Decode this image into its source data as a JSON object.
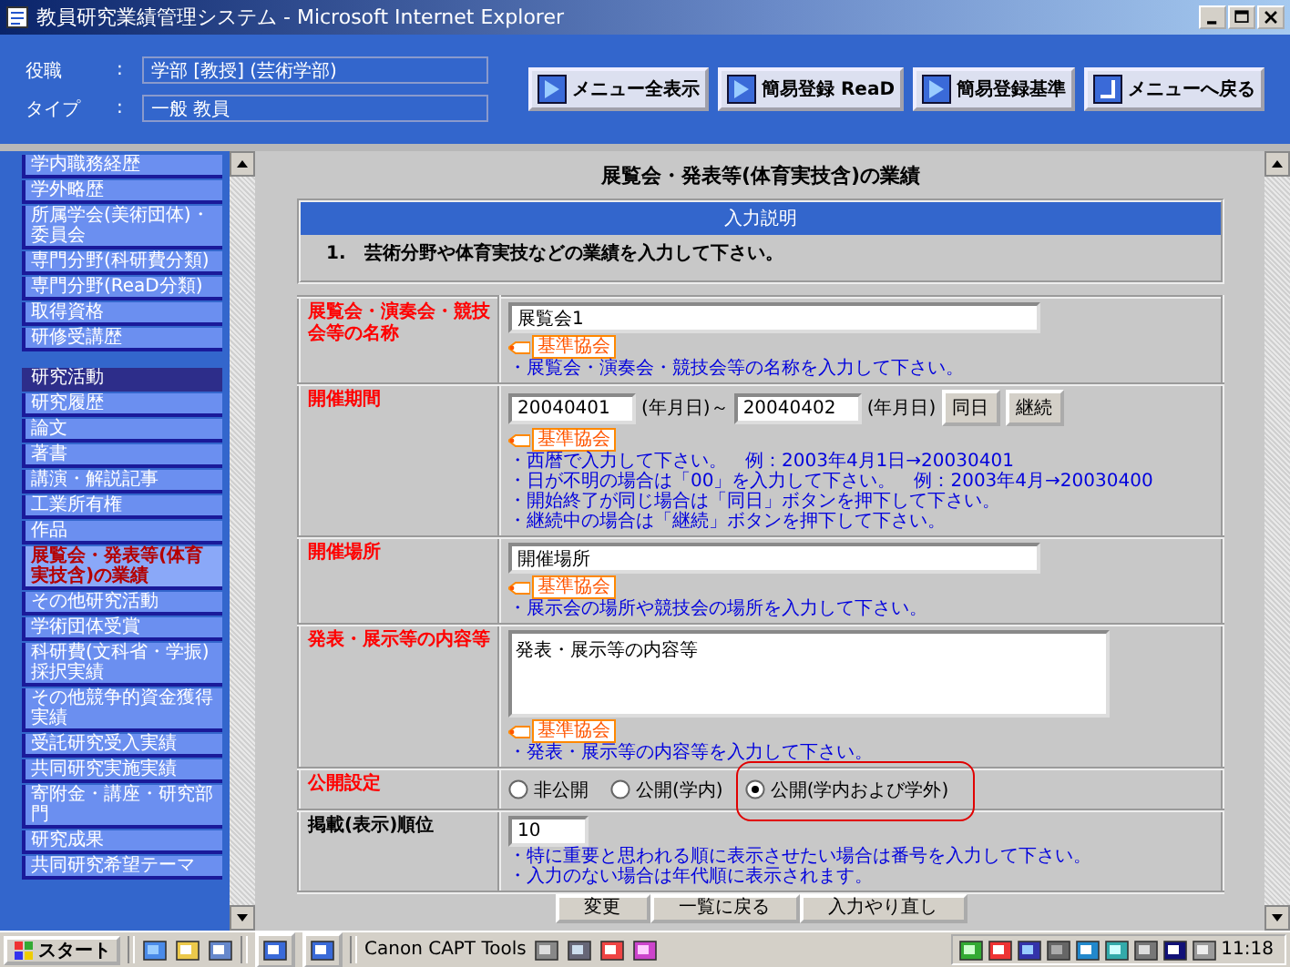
{
  "window": {
    "title": "教員研究業績管理システム - Microsoft Internet Explorer"
  },
  "header": {
    "fields": [
      {
        "label": "役職",
        "separator": ":",
        "value": "学部 [教授] (芸術学部)"
      },
      {
        "label": "タイプ",
        "separator": ":",
        "value": "一般 教員"
      }
    ],
    "buttons": [
      "メニュー全表示",
      "簡易登録 ReaD",
      "簡易登録基準",
      "メニューへ戻る"
    ]
  },
  "sidebar": {
    "items": [
      {
        "kind": "item",
        "label": "学内職務経歴",
        "selected": false
      },
      {
        "kind": "item",
        "label": "学外略歴",
        "selected": false
      },
      {
        "kind": "item",
        "label": "所属学会(美術団体)・委員会",
        "selected": false
      },
      {
        "kind": "item",
        "label": "専門分野(科研費分類)",
        "selected": false
      },
      {
        "kind": "item",
        "label": "専門分野(ReaD分類)",
        "selected": false
      },
      {
        "kind": "item",
        "label": "取得資格",
        "selected": false
      },
      {
        "kind": "item",
        "label": "研修受講歴",
        "selected": false
      },
      {
        "kind": "heading",
        "label": "研究活動"
      },
      {
        "kind": "item",
        "label": "研究履歴",
        "selected": false
      },
      {
        "kind": "item",
        "label": "論文",
        "selected": false
      },
      {
        "kind": "item",
        "label": "著書",
        "selected": false
      },
      {
        "kind": "item",
        "label": "講演・解説記事",
        "selected": false
      },
      {
        "kind": "item",
        "label": "工業所有権",
        "selected": false
      },
      {
        "kind": "item",
        "label": "作品",
        "selected": false
      },
      {
        "kind": "item",
        "label": "展覧会・発表等(体育実技含)の業績",
        "selected": true
      },
      {
        "kind": "item",
        "label": "その他研究活動",
        "selected": false
      },
      {
        "kind": "item",
        "label": "学術団体受賞",
        "selected": false
      },
      {
        "kind": "item",
        "label": "科研費(文科省・学振)採択実績",
        "selected": false
      },
      {
        "kind": "item",
        "label": "その他競争的資金獲得実績",
        "selected": false
      },
      {
        "kind": "item",
        "label": "受託研究受入実績",
        "selected": false
      },
      {
        "kind": "item",
        "label": "共同研究実施実績",
        "selected": false
      },
      {
        "kind": "item",
        "label": "寄附金・講座・研究部門",
        "selected": false
      },
      {
        "kind": "item",
        "label": "研究成果",
        "selected": false
      },
      {
        "kind": "item",
        "label": "共同研究希望テーマ",
        "selected": false
      }
    ]
  },
  "main": {
    "title": "展覧会・発表等(体育実技含)の業績",
    "instructions": {
      "heading": "入力説明",
      "lines": [
        "1.　芸術分野や体育実技などの業績を入力して下さい。"
      ]
    },
    "form": [
      {
        "kind": "text",
        "label": "展覧会・演奏会・競技会等の名称",
        "required": true,
        "value": "展覧会1",
        "badge": "基準協会",
        "hints": [
          "・展覧会・演奏会・競技会等の名称を入力して下さい。"
        ]
      },
      {
        "kind": "period",
        "label": "開催期間",
        "required": true,
        "from": "20040401",
        "from_unit": "(年月日)～",
        "to": "20040402",
        "to_unit": "(年月日)",
        "buttons": [
          "同日",
          "継続"
        ],
        "badge": "基準協会",
        "hints": [
          "・西暦で入力して下さい。　例：2003年4月1日→20030401",
          "・日が不明の場合は「00」を入力して下さい。　例：2003年4月→20030400",
          "・開始終了が同じ場合は「同日」ボタンを押下して下さい。",
          "・継続中の場合は「継続」ボタンを押下して下さい。"
        ]
      },
      {
        "kind": "text",
        "label": "開催場所",
        "required": true,
        "value": "開催場所",
        "badge": "基準協会",
        "hints": [
          "・展示会の場所や競技会の場所を入力して下さい。"
        ]
      },
      {
        "kind": "textarea",
        "label": "発表・展示等の内容等",
        "required": true,
        "value": "発表・展示等の内容等",
        "badge": "基準協会",
        "hints": [
          "・発表・展示等の内容等を入力して下さい。"
        ]
      },
      {
        "kind": "radio",
        "label": "公開設定",
        "required": true,
        "options": [
          {
            "label": "非公開",
            "selected": false,
            "highlighted": false
          },
          {
            "label": "公開(学内)",
            "selected": false,
            "highlighted": false
          },
          {
            "label": "公開(学内および学外)",
            "selected": true,
            "highlighted": true
          }
        ]
      },
      {
        "kind": "short",
        "label": "掲載(表示)順位",
        "required": false,
        "value": "10",
        "hints": [
          "・特に重要と思われる順に表示させたい場合は番号を入力して下さい。",
          "・入力のない場合は年代順に表示されます。"
        ]
      }
    ],
    "buttons": [
      "変更",
      "一覧に戻る",
      "入力やり直し"
    ]
  },
  "taskbar": {
    "start": "スタート",
    "app": "Canon CAPT Tools",
    "clock": "11:18"
  }
}
